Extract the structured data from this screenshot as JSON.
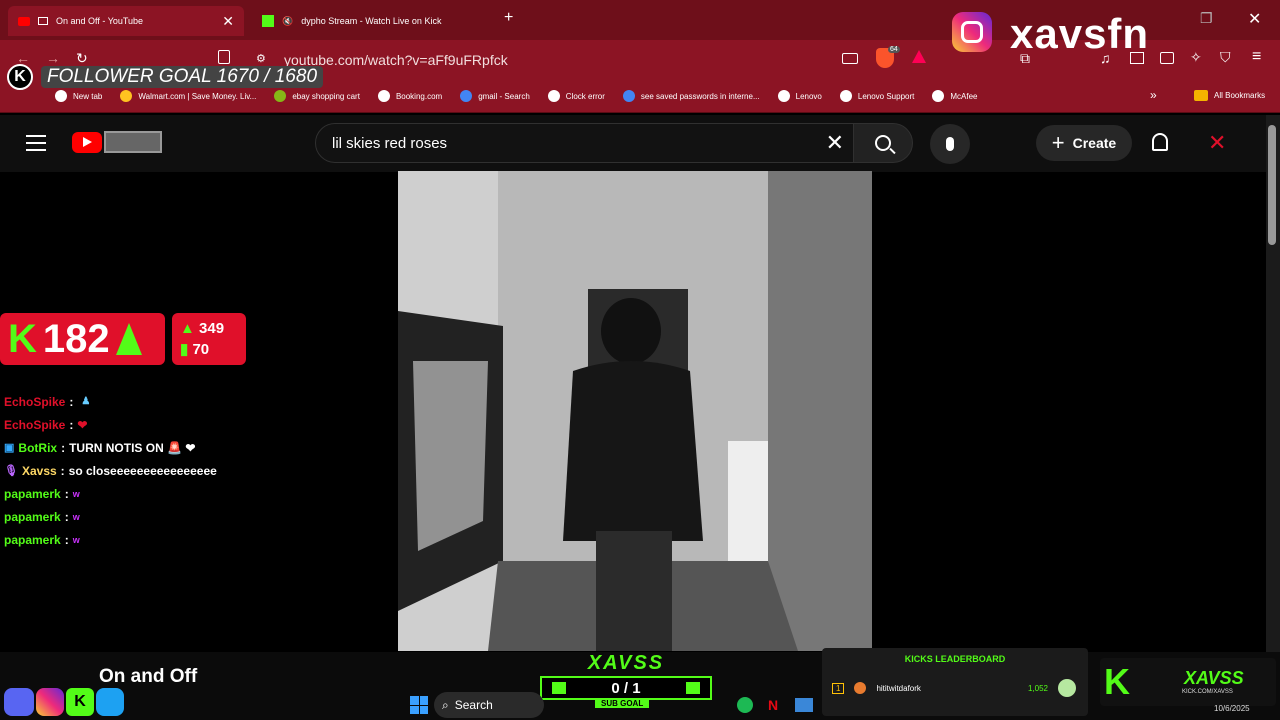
{
  "tabs": [
    {
      "title": "On and Off - YouTube",
      "close": "✕"
    },
    {
      "title": "dypho Stream - Watch Live on Kick"
    }
  ],
  "new_tab": "+",
  "address": "youtube.com/watch?v=aFf9uFRpfck",
  "shield_count": "64",
  "bookmarks": [
    "New tab",
    "Walmart.com | Save Money. Liv...",
    "ebay shopping cart",
    "Booking.com",
    "gmail - Search",
    "Clock error",
    "see saved passwords in interne...",
    "Lenovo",
    "Lenovo Support",
    "McAfee"
  ],
  "all_bookmarks": "All Bookmarks",
  "overlay": {
    "instagram_handle": "xavsfn",
    "follower_goal": "FOLLOWER GOAL 1670 / 1680",
    "viewer_count": "182",
    "stat_followers": "349",
    "stat_subs": "70",
    "chat": [
      {
        "user": "EchoSpike",
        "msg": "",
        "color": "#e0102a"
      },
      {
        "user": "EchoSpike",
        "msg": "❤",
        "color": "#e0102a"
      },
      {
        "user": "BotRix",
        "msg": "TURN NOTIS ON 🚨 ❤",
        "color": "#53fc18"
      },
      {
        "user": "Xavss",
        "msg": "so closeeeeeeeeeeeeeeee",
        "color": "#ffd966"
      },
      {
        "user": "papamerk",
        "msg": "",
        "color": "#53fc18"
      },
      {
        "user": "papamerk",
        "msg": "",
        "color": "#53fc18"
      },
      {
        "user": "papamerk",
        "msg": "",
        "color": "#53fc18"
      }
    ],
    "sub_brand": "XAVSS",
    "sub_count": "0 / 1",
    "sub_goal": "SUB GOAL",
    "leaderboard_title": "KICKS LEADERBOARD",
    "leaderboard_rank": "1",
    "leaderboard_user": "hititwitdafork",
    "leaderboard_value": "1,052",
    "kick_brand": "XAVSS",
    "kick_url": "KICK.COM/XAVSS"
  },
  "youtube": {
    "search_value": "lil skies red roses",
    "create_label": "Create",
    "video_title": "On and Off"
  },
  "taskbar": {
    "search_label": "Search",
    "date": "10/6/2025"
  },
  "colors": {
    "brand": "#8c1424",
    "kick": "#53fc18",
    "yt_red": "#ff0000"
  }
}
